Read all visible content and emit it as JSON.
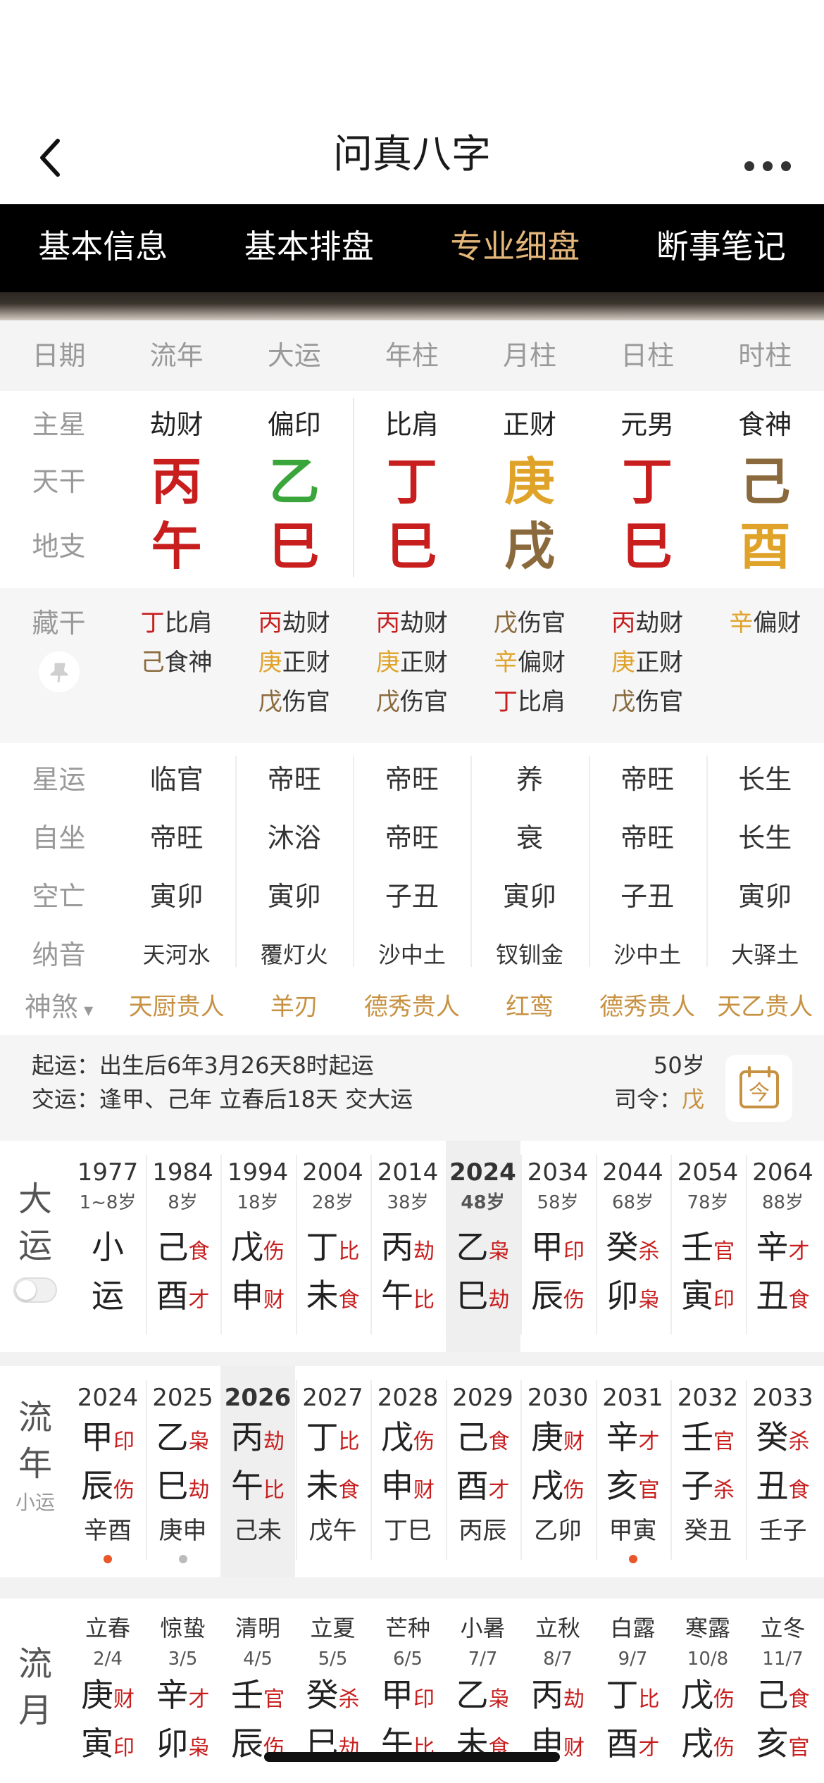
{
  "header": {
    "title": "问真八字"
  },
  "tabs": [
    {
      "label": "基本信息",
      "active": false
    },
    {
      "label": "基本排盘",
      "active": false
    },
    {
      "label": "专业细盘",
      "active": true
    },
    {
      "label": "断事笔记",
      "active": false
    }
  ],
  "columns": [
    "日期",
    "流年",
    "大运",
    "年柱",
    "月柱",
    "日柱",
    "时柱"
  ],
  "main_star": {
    "label": "主星",
    "values": [
      "劫财",
      "偏印",
      "比肩",
      "正财",
      "元男",
      "食神"
    ]
  },
  "tiangan": {
    "label": "天干",
    "values": [
      {
        "char": "丙",
        "color": "#c81e1e"
      },
      {
        "char": "乙",
        "color": "#3aa53a"
      },
      {
        "char": "丁",
        "color": "#c81e1e"
      },
      {
        "char": "庚",
        "color": "#e0a32a"
      },
      {
        "char": "丁",
        "color": "#c81e1e"
      },
      {
        "char": "己",
        "color": "#8a6a3c"
      }
    ]
  },
  "dizhi": {
    "label": "地支",
    "values": [
      {
        "char": "午",
        "color": "#c81e1e"
      },
      {
        "char": "巳",
        "color": "#c81e1e"
      },
      {
        "char": "巳",
        "color": "#c81e1e"
      },
      {
        "char": "戌",
        "color": "#8a6a3c"
      },
      {
        "char": "巳",
        "color": "#c81e1e"
      },
      {
        "char": "酉",
        "color": "#e0a32a"
      }
    ]
  },
  "canggan": {
    "label": "藏干",
    "columns": [
      [
        {
          "g": "丁",
          "c": "#c81e1e",
          "t": "比肩"
        },
        {
          "g": "己",
          "c": "#8a6a3c",
          "t": "食神"
        }
      ],
      [
        {
          "g": "丙",
          "c": "#c81e1e",
          "t": "劫财"
        },
        {
          "g": "庚",
          "c": "#e0a32a",
          "t": "正财"
        },
        {
          "g": "戊",
          "c": "#8a6a3c",
          "t": "伤官"
        }
      ],
      [
        {
          "g": "丙",
          "c": "#c81e1e",
          "t": "劫财"
        },
        {
          "g": "庚",
          "c": "#e0a32a",
          "t": "正财"
        },
        {
          "g": "戊",
          "c": "#8a6a3c",
          "t": "伤官"
        }
      ],
      [
        {
          "g": "戊",
          "c": "#8a6a3c",
          "t": "伤官"
        },
        {
          "g": "辛",
          "c": "#e0a32a",
          "t": "偏财"
        },
        {
          "g": "丁",
          "c": "#c81e1e",
          "t": "比肩"
        }
      ],
      [
        {
          "g": "丙",
          "c": "#c81e1e",
          "t": "劫财"
        },
        {
          "g": "庚",
          "c": "#e0a32a",
          "t": "正财"
        },
        {
          "g": "戊",
          "c": "#8a6a3c",
          "t": "伤官"
        }
      ],
      [
        {
          "g": "辛",
          "c": "#e0a32a",
          "t": "偏财"
        }
      ]
    ]
  },
  "info_rows": [
    {
      "label": "星运",
      "values": [
        "临官",
        "帝旺",
        "帝旺",
        "养",
        "帝旺",
        "长生"
      ]
    },
    {
      "label": "自坐",
      "values": [
        "帝旺",
        "沐浴",
        "帝旺",
        "衰",
        "帝旺",
        "长生"
      ]
    },
    {
      "label": "空亡",
      "values": [
        "寅卯",
        "寅卯",
        "子丑",
        "寅卯",
        "子丑",
        "寅卯"
      ]
    },
    {
      "label": "纳音",
      "values": [
        "天河水",
        "覆灯火",
        "沙中土",
        "钗钏金",
        "沙中土",
        "大驿土"
      ]
    }
  ],
  "shensha": {
    "label": "神煞",
    "values": [
      "天厨贵人",
      "羊刃",
      "德秀贵人",
      "红鸾",
      "德秀贵人",
      "天乙贵人"
    ]
  },
  "qiyun": {
    "line1": "起运：出生后6年3月26天8时起运",
    "line2": "交运：逢甲、己年 立春后18天 交大运",
    "age": "50岁",
    "siling_label": "司令：",
    "siling_value": "戊",
    "calendar_char": "今"
  },
  "dayun": {
    "side": [
      "大",
      "运"
    ],
    "items": [
      {
        "year": "1977",
        "age": "1~8岁",
        "g": "小",
        "gs": "",
        "z": "运",
        "zs": ""
      },
      {
        "year": "1984",
        "age": "8岁",
        "g": "己",
        "gs": "食",
        "z": "酉",
        "zs": "才"
      },
      {
        "year": "1994",
        "age": "18岁",
        "g": "戊",
        "gs": "伤",
        "z": "申",
        "zs": "财"
      },
      {
        "year": "2004",
        "age": "28岁",
        "g": "丁",
        "gs": "比",
        "z": "未",
        "zs": "食"
      },
      {
        "year": "2014",
        "age": "38岁",
        "g": "丙",
        "gs": "劫",
        "z": "午",
        "zs": "比"
      },
      {
        "year": "2024",
        "age": "48岁",
        "g": "乙",
        "gs": "枭",
        "z": "巳",
        "zs": "劫",
        "selected": true
      },
      {
        "year": "2034",
        "age": "58岁",
        "g": "甲",
        "gs": "印",
        "z": "辰",
        "zs": "伤"
      },
      {
        "year": "2044",
        "age": "68岁",
        "g": "癸",
        "gs": "杀",
        "z": "卯",
        "zs": "枭"
      },
      {
        "year": "2054",
        "age": "78岁",
        "g": "壬",
        "gs": "官",
        "z": "寅",
        "zs": "印"
      },
      {
        "year": "2064",
        "age": "88岁",
        "g": "辛",
        "gs": "才",
        "z": "丑",
        "zs": "食"
      }
    ]
  },
  "liunian": {
    "side": [
      "流",
      "年"
    ],
    "side_small": "小运",
    "items": [
      {
        "year": "2024",
        "g": "甲",
        "gs": "印",
        "z": "辰",
        "zs": "伤",
        "sub": "辛酉",
        "dot": "#e8562a"
      },
      {
        "year": "2025",
        "g": "乙",
        "gs": "枭",
        "z": "巳",
        "zs": "劫",
        "sub": "庚申",
        "dot": "#bbbbbb"
      },
      {
        "year": "2026",
        "g": "丙",
        "gs": "劫",
        "z": "午",
        "zs": "比",
        "sub": "己未",
        "selected": true
      },
      {
        "year": "2027",
        "g": "丁",
        "gs": "比",
        "z": "未",
        "zs": "食",
        "sub": "戊午"
      },
      {
        "year": "2028",
        "g": "戊",
        "gs": "伤",
        "z": "申",
        "zs": "财",
        "sub": "丁巳"
      },
      {
        "year": "2029",
        "g": "己",
        "gs": "食",
        "z": "酉",
        "zs": "才",
        "sub": "丙辰"
      },
      {
        "year": "2030",
        "g": "庚",
        "gs": "财",
        "z": "戌",
        "zs": "伤",
        "sub": "乙卯"
      },
      {
        "year": "2031",
        "g": "辛",
        "gs": "才",
        "z": "亥",
        "zs": "官",
        "sub": "甲寅",
        "dot": "#e8562a"
      },
      {
        "year": "2032",
        "g": "壬",
        "gs": "官",
        "z": "子",
        "zs": "杀",
        "sub": "癸丑"
      },
      {
        "year": "2033",
        "g": "癸",
        "gs": "杀",
        "z": "丑",
        "zs": "食",
        "sub": "壬子"
      }
    ]
  },
  "liuyue": {
    "side": [
      "流",
      "月"
    ],
    "items": [
      {
        "term": "立春",
        "date": "2/4",
        "g": "庚",
        "gs": "财",
        "z": "寅",
        "zs": "印"
      },
      {
        "term": "惊蛰",
        "date": "3/5",
        "g": "辛",
        "gs": "才",
        "z": "卯",
        "zs": "枭"
      },
      {
        "term": "清明",
        "date": "4/5",
        "g": "壬",
        "gs": "官",
        "z": "辰",
        "zs": "伤"
      },
      {
        "term": "立夏",
        "date": "5/5",
        "g": "癸",
        "gs": "杀",
        "z": "巳",
        "zs": "劫"
      },
      {
        "term": "芒种",
        "date": "6/5",
        "g": "甲",
        "gs": "印",
        "z": "午",
        "zs": "比"
      },
      {
        "term": "小暑",
        "date": "7/7",
        "g": "乙",
        "gs": "枭",
        "z": "未",
        "zs": "食"
      },
      {
        "term": "立秋",
        "date": "8/7",
        "g": "丙",
        "gs": "劫",
        "z": "申",
        "zs": "财"
      },
      {
        "term": "白露",
        "date": "9/7",
        "g": "丁",
        "gs": "比",
        "z": "酉",
        "zs": "才"
      },
      {
        "term": "寒露",
        "date": "10/8",
        "g": "戊",
        "gs": "伤",
        "z": "戌",
        "zs": "伤"
      },
      {
        "term": "立冬",
        "date": "11/7",
        "g": "己",
        "gs": "食",
        "z": "亥",
        "zs": "官"
      }
    ]
  }
}
